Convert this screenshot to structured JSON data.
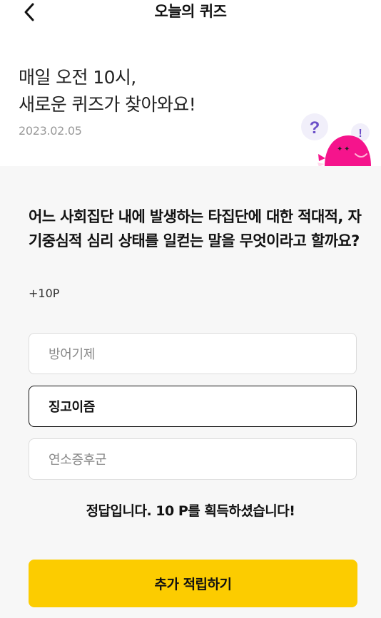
{
  "header": {
    "title": "오늘의 퀴즈",
    "back_icon": "chevron-left-icon"
  },
  "intro": {
    "line1": "매일 오전 10시,",
    "line2": "새로운 퀴즈가 찾아와요!",
    "date": "2023.02.05"
  },
  "mascot": {
    "question_mark": "?",
    "exclamation_mark": "!",
    "body_color": "#f5148c"
  },
  "quiz": {
    "question": "어느 사회집단 내에 발생하는 타집단에 대한 적대적, 자기중심적 심리 상태를 일컫는 말을 무엇이라고 할까요?",
    "points": "+10P",
    "options": [
      {
        "label": "방어기제",
        "selected": false
      },
      {
        "label": "징고이즘",
        "selected": true
      },
      {
        "label": "연소증후군",
        "selected": false
      }
    ],
    "result_message": "정답입니다. 10 P를 획득하셨습니다!"
  },
  "cta": {
    "label": "추가 적립하기",
    "color": "#fccc00"
  }
}
